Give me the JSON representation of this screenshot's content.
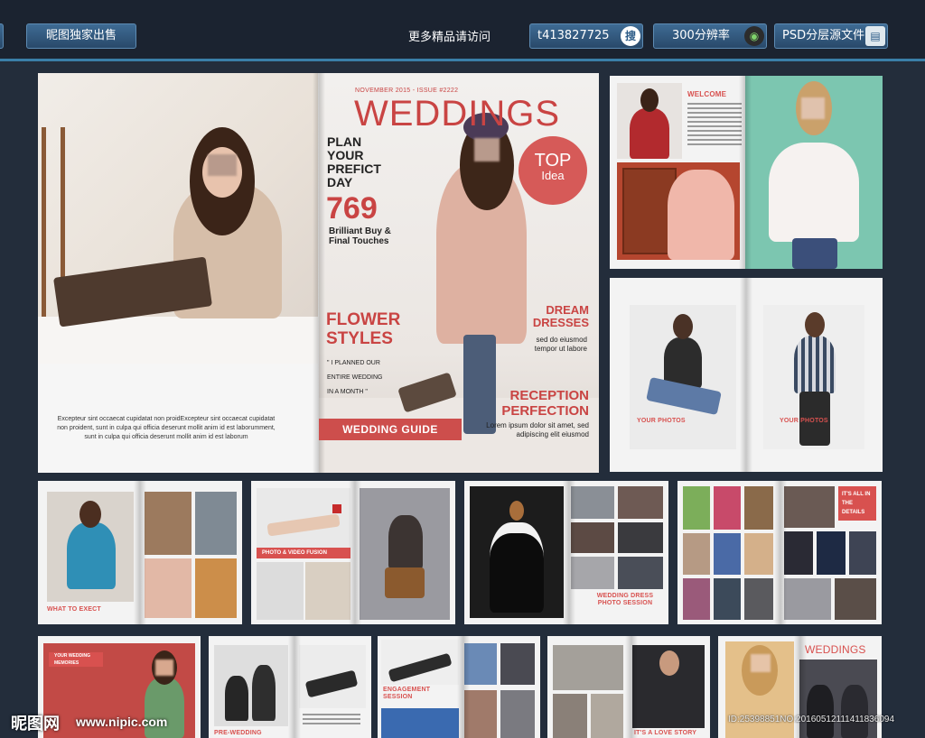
{
  "topbar": {
    "exclusive_label": "昵图独家出售",
    "visit_text": "更多精品请访问",
    "search_id": "t413827725",
    "search_icon_text": "搜",
    "resolution_label": "300分辨率",
    "psd_label": "PSD分层源文件"
  },
  "main_spread": {
    "left_page_text": "Excepteur sint occaecat cupidatat non proidExcepteur sint occaecat cupidatat non proident, sunt in culpa qui officia deserunt mollit anim id est laborumment, sunt in culpa qui officia deserunt mollit anim id est laborum",
    "cover": {
      "issue": "NOVEMBER 2015 - ISSUE #2222",
      "title": "WEDDINGS",
      "plan": "PLAN YOUR PREFICT DAY",
      "number": "769",
      "number_sub": "Brilliant Buy & Final Touches",
      "top_tag_1": "TOP",
      "top_tag_2": "Idea",
      "flower": "FLOWER STYLES",
      "quote_1": "\" I PLANNED OUR",
      "quote_2": "ENTIRE WEDDING",
      "quote_3": "IN A MONTH \"",
      "dream": "DREAM DRESSES",
      "dream_sub": "sed do eiusmod tempor ut labore",
      "reception": "RECEPTION PERFECTION",
      "reception_sub": "Lorem ipsum dolor sit amet, sed adipiscing elit eiusmod",
      "guide": "WEDDING GUIDE"
    }
  },
  "right_top": {
    "welcome": "WELCOME"
  },
  "right_mid": {
    "left_caption": "YOUR PHOTOS",
    "right_caption": "YOUR PHOTOS"
  },
  "row2": {
    "p1_caption": "WHAT TO EXECT",
    "p2_bar": "PHOTO & VIDEO FUSION",
    "p3_caption_1": "WEDDING DRESS",
    "p3_caption_2": "PHOTO SESSION",
    "p4_bar": "IT'S ALL IN THE DETAILS"
  },
  "row3": {
    "p1_bar_1": "YOUR WEDDING DAY",
    "p1_bar_2": "MEMORIES",
    "p2_caption_1": "PRE-WEDDING",
    "p3_caption_1": "ENGAGEMENT",
    "p3_caption_2": "SESSION",
    "p4_caption": "IT'S A LOVE STORY",
    "p5_title": "WEDDINGS"
  },
  "watermark": {
    "logo": "昵图网",
    "url": "www.nipic.com",
    "id": "ID:25398851NO:20160512111411836094"
  },
  "colors": {
    "accent_red": "#d8514f",
    "background": "#232d3b",
    "topbar": "#1b2330",
    "button_blue": "#3e6b94"
  }
}
